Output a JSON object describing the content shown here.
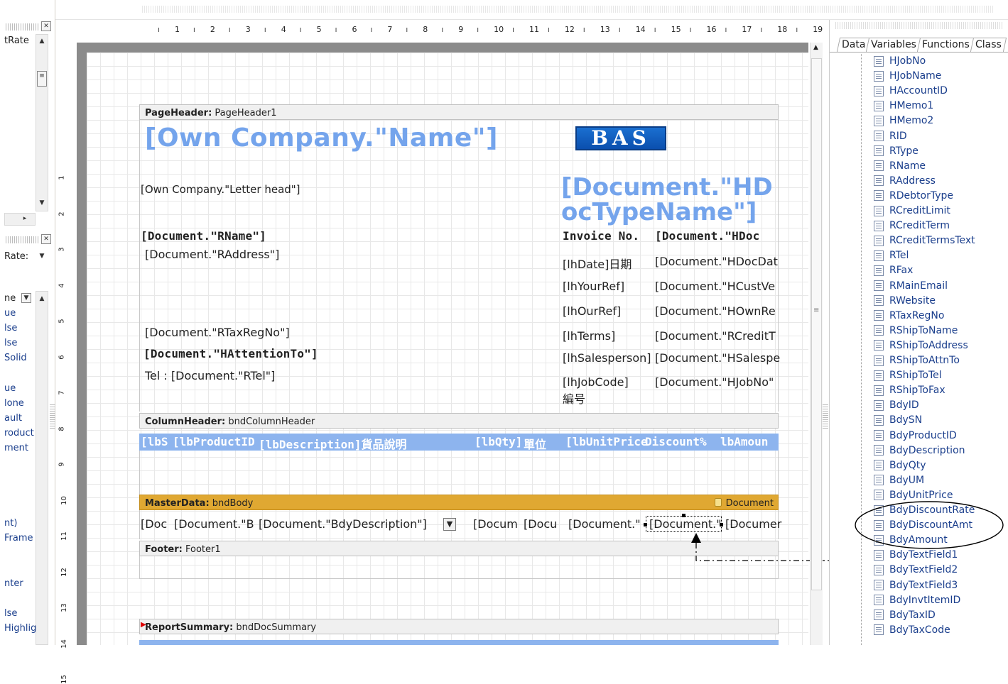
{
  "left_panel": {
    "labels": [
      "tRate",
      "Rate:",
      "ne",
      "ue",
      "lse",
      "lse",
      "Solid",
      "ue",
      "lone",
      "ault",
      "roduct",
      "ment",
      "nt)",
      "Frame",
      "nter",
      "lse",
      "Highlig"
    ]
  },
  "ruler": {
    "h_ticks": [
      "1",
      "2",
      "3",
      "4",
      "5",
      "6",
      "7",
      "8",
      "9",
      "10",
      "11",
      "12",
      "13",
      "14",
      "15",
      "16",
      "17",
      "18",
      "19"
    ],
    "v_ticks": [
      "1",
      "2",
      "3",
      "4",
      "5",
      "6",
      "7",
      "8",
      "9",
      "10",
      "11",
      "12",
      "13",
      "14",
      "15"
    ]
  },
  "report": {
    "page_header": {
      "type": "PageHeader:",
      "name": "PageHeader1"
    },
    "own_company_name": "[Own Company.\"Name\"]",
    "logo": "BAS",
    "letter_head": "[Own Company.\"Letter head\"]",
    "doc_type_line1": "[Document.\"HD",
    "doc_type_line2": "ocTypeName\"]",
    "rname": "[Document.\"RName\"]",
    "raddress": "[Document.\"RAddress\"]",
    "rtaxregno": "[Document.\"RTaxRegNo\"]",
    "hattention": "[Document.\"HAttentionTo\"]",
    "tel": "Tel : [Document.\"RTel\"]",
    "invoice_no": "Invoice No.",
    "hdoc": "[Document.\"HDoc",
    "lh_date": "[lhDate]日期",
    "hdocdat": "[Document.\"HDocDat",
    "lh_yourref": "[lhYourRef]",
    "hcustve": "[Document.\"HCustVe",
    "lh_ourref": "[lhOurRef]",
    "hownre": "[Document.\"HOwnRe",
    "lh_terms": "[lhTerms]",
    "rcreditt": "[Document.\"RCreditT",
    "lh_salesperson": "[lhSalesperson]",
    "hsalespe": "[Document.\"HSalespe",
    "lh_jobcode": "[lhJobCode]",
    "jobcode_cn": "編号",
    "hjobno": "[Document.\"HJobNo\"",
    "column_header": {
      "type": "ColumnHeader:",
      "name": "bndColumnHeader"
    },
    "columns": [
      "[lbS",
      "[lbProductID",
      "[lbDescription]貨品說明",
      "[lbQty]",
      "單位",
      "[lbUnitPrice",
      "Discount%",
      "lbAmoun"
    ],
    "master_data": {
      "type": "MasterData:",
      "name": "bndBody",
      "source": "Document"
    },
    "body_cells": [
      "[Doc",
      "[Document.\"B",
      "[Document.\"BdyDescription\"]",
      "[Docum",
      "[Docu",
      "[Document.\"",
      "[Document.\"",
      "[Documer"
    ],
    "footer": {
      "type": "Footer:",
      "name": "Footer1"
    },
    "summary": {
      "type": "ReportSummary:",
      "name": "bndDocSummary"
    }
  },
  "right_panel": {
    "tabs": [
      "Data",
      "Variables",
      "Functions",
      "Class"
    ],
    "fields": [
      "HJobNo",
      "HJobName",
      "HAccountID",
      "HMemo1",
      "HMemo2",
      "RID",
      "RType",
      "RName",
      "RAddress",
      "RDebtorType",
      "RCreditLimit",
      "RCreditTerm",
      "RCreditTermsText",
      "RTel",
      "RFax",
      "RMainEmail",
      "RWebsite",
      "RTaxRegNo",
      "RShipToName",
      "RShipToAddress",
      "RShipToAttnTo",
      "RShipToTel",
      "RShipToFax",
      "BdyID",
      "BdySN",
      "BdyProductID",
      "BdyDescription",
      "BdyQty",
      "BdyUM",
      "BdyUnitPrice",
      "BdyDiscountRate",
      "BdyDiscountAmt",
      "BdyAmount",
      "BdyTextField1",
      "BdyTextField2",
      "BdyTextField3",
      "BdyInvtItemID",
      "BdyTaxID",
      "BdyTaxCode"
    ]
  }
}
